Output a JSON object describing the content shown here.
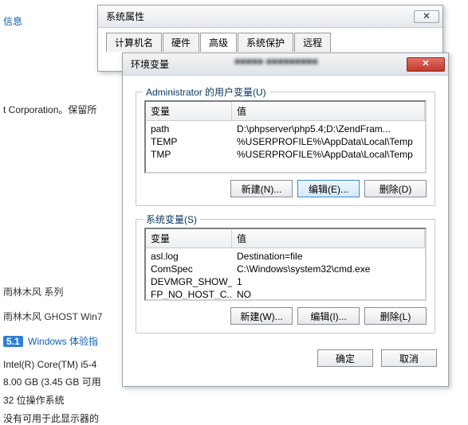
{
  "bg": {
    "info": "信息",
    "copyright": "t Corporation。保留所",
    "brand_line": "雨林木风 系列",
    "ghost_line": "雨林木风 GHOST Win7",
    "badge": "5.1",
    "wei_link": "Windows 体验指",
    "cpu": "Intel(R) Core(TM) i5-4",
    "ram": "8.00 GB (3.45 GB 可用",
    "arch": "32 位操作系统",
    "pen": "没有可用于此显示器的"
  },
  "sysprops": {
    "title": "系统属性",
    "tabs": [
      "计算机名",
      "硬件",
      "高级",
      "系统保护",
      "远程"
    ]
  },
  "envdlg": {
    "title": "环境变量",
    "blurred": "■■■■■   ■■■■■■■■■",
    "user_group_label": "Administrator 的用户变量(U)",
    "sys_group_label": "系统变量(S)",
    "col_name": "变量",
    "col_value": "值",
    "user_vars": [
      {
        "name": "path",
        "value": "D:\\phpserver\\php5.4;D:\\ZendFram..."
      },
      {
        "name": "TEMP",
        "value": "%USERPROFILE%\\AppData\\Local\\Temp"
      },
      {
        "name": "TMP",
        "value": "%USERPROFILE%\\AppData\\Local\\Temp"
      }
    ],
    "sys_vars": [
      {
        "name": "asl.log",
        "value": "Destination=file"
      },
      {
        "name": "ComSpec",
        "value": "C:\\Windows\\system32\\cmd.exe"
      },
      {
        "name": "DEVMGR_SHOW_...",
        "value": "1"
      },
      {
        "name": "FP_NO_HOST_C...",
        "value": "NO"
      }
    ],
    "btn_new_u": "新建(N)...",
    "btn_edit_u": "编辑(E)...",
    "btn_del_u": "删除(D)",
    "btn_new_s": "新建(W)...",
    "btn_edit_s": "编辑(I)...",
    "btn_del_s": "删除(L)",
    "ok": "确定",
    "cancel": "取消"
  }
}
